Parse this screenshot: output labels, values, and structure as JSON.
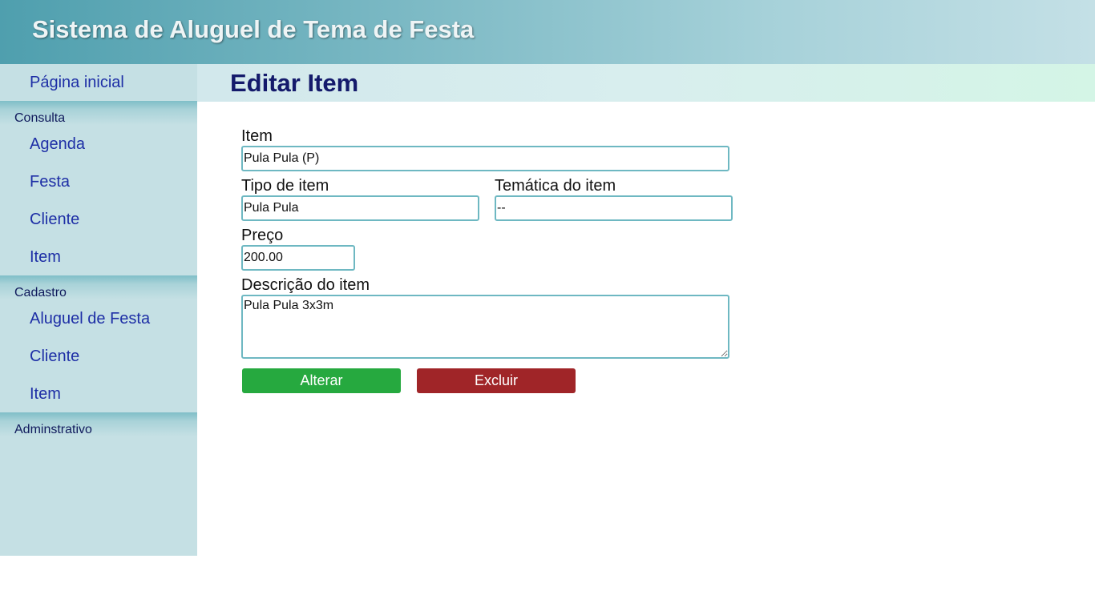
{
  "header": {
    "title": "Sistema de Aluguel de Tema de Festa"
  },
  "sidebar": {
    "home": "Página inicial",
    "sections": [
      {
        "label": "Consulta",
        "items": [
          "Agenda",
          "Festa",
          "Cliente",
          "Item"
        ]
      },
      {
        "label": "Cadastro",
        "items": [
          "Aluguel de Festa",
          "Cliente",
          "Item"
        ]
      },
      {
        "label": "Adminstrativo",
        "items": []
      }
    ]
  },
  "page": {
    "title": "Editar Item"
  },
  "form": {
    "item": {
      "label": "Item",
      "value": "Pula Pula (P)"
    },
    "tipo": {
      "label": "Tipo de item",
      "value": "Pula Pula"
    },
    "tematica": {
      "label": "Temática do item",
      "value": "--"
    },
    "preco": {
      "label": "Preço",
      "value": "200.00"
    },
    "descricao": {
      "label": "Descrição do item",
      "value": "Pula Pula 3x3m"
    },
    "alterar_label": "Alterar",
    "excluir_label": "Excluir"
  },
  "colors": {
    "alterar_button": "#26a93f",
    "excluir_button": "#a02528",
    "sidebar_bg": "#c5e0e4",
    "link_color": "#1e2fa6",
    "input_border": "#6eb8c2"
  }
}
